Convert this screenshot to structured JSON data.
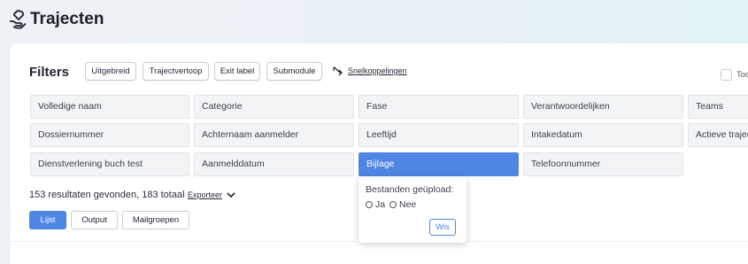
{
  "page": {
    "title": "Trajecten",
    "title_icon": "hand-heart-icon"
  },
  "filters": {
    "label": "Filters",
    "toolbar_buttons": [
      {
        "label": "Uitgebreid"
      },
      {
        "label": "Trajectverloop"
      },
      {
        "label": "Exit label"
      },
      {
        "label": "Submodule"
      }
    ],
    "quicklinks": {
      "label": "Snelkoppelingen",
      "icon": "link-arrow-icon"
    },
    "checkbox_label": "Too",
    "grid": [
      [
        "Volledige naam",
        "Categorie",
        "Fase",
        "Verantwoordelijken",
        "Teams"
      ],
      [
        "Dossiernummer",
        "Achternaam aanmelder",
        "Leeftijd",
        "Intakedatum",
        "Actieve trajec"
      ],
      [
        "Dienstverlening buch test",
        "Aanmelddatum",
        "Bijlage",
        "Telefoonnummer"
      ]
    ],
    "active_filter": "Bijlage"
  },
  "popover": {
    "title": "Bestanden geüpload:",
    "options": [
      "Ja",
      "Nee"
    ],
    "clear_label": "Wis"
  },
  "results": {
    "summary": "153 resultaten gevonden, 183 totaal",
    "export_label": "Exporteer"
  },
  "view_tabs": [
    {
      "label": "Lijst",
      "active": true
    },
    {
      "label": "Output",
      "active": false
    },
    {
      "label": "Mailgroepen",
      "active": false
    }
  ],
  "colors": {
    "accent": "#4f86e3",
    "cell_bg": "#f3f4f6",
    "header_bg": "#eef1f6"
  }
}
